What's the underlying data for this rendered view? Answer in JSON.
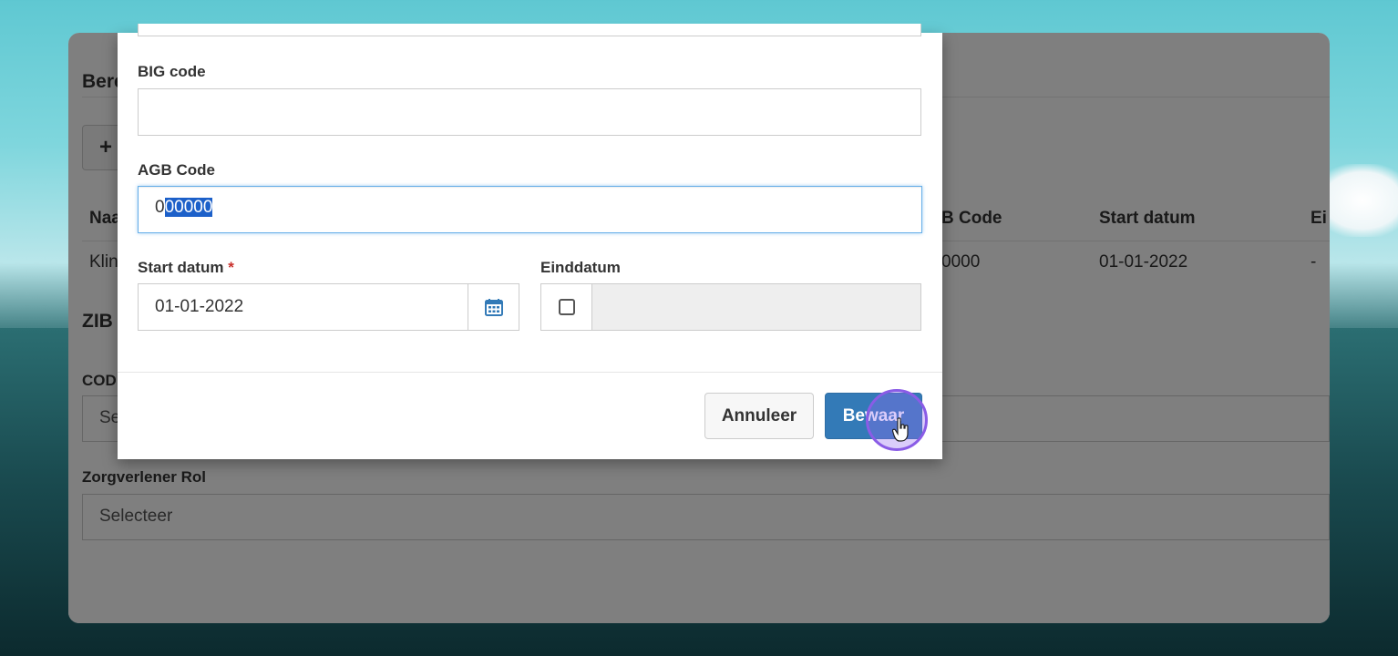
{
  "background": {
    "colors": {
      "sky": "#7fd6dd",
      "hills": "#1a4b50"
    }
  },
  "app": {
    "section_heading_1": "Bere",
    "add_button_label": "+",
    "table": {
      "headers": {
        "name_partial": "Naa",
        "agb_code_partial": "B Code",
        "start_datum": "Start datum",
        "eind_partial": "Ei"
      },
      "row": {
        "name_partial": "Klin",
        "agb_code_partial": "0000",
        "start_datum": "01-01-2022",
        "eind": "-"
      }
    },
    "section_heading_2": "ZIB",
    "code_label_partial": "COD",
    "code_select_partial": "Se",
    "zorgverlener_rol_label": "Zorgverlener Rol",
    "zorgverlener_rol_select": "Selecteer"
  },
  "modal": {
    "big_code": {
      "label": "BIG code",
      "value": ""
    },
    "agb_code": {
      "label": "AGB Code",
      "value_unselected": "0",
      "value_selected": "00000"
    },
    "start_datum": {
      "label": "Start datum",
      "required_marker": "*",
      "value": "01-01-2022",
      "icon": "calendar-icon"
    },
    "einddatum": {
      "label": "Einddatum",
      "checked": false,
      "value": ""
    },
    "buttons": {
      "cancel": "Annuleer",
      "save": "Bewaar"
    },
    "colors": {
      "primary": "#337ab7",
      "required": "#c9302c",
      "selection": "#1c60c9",
      "click_ring": "#8a5ce6"
    }
  }
}
